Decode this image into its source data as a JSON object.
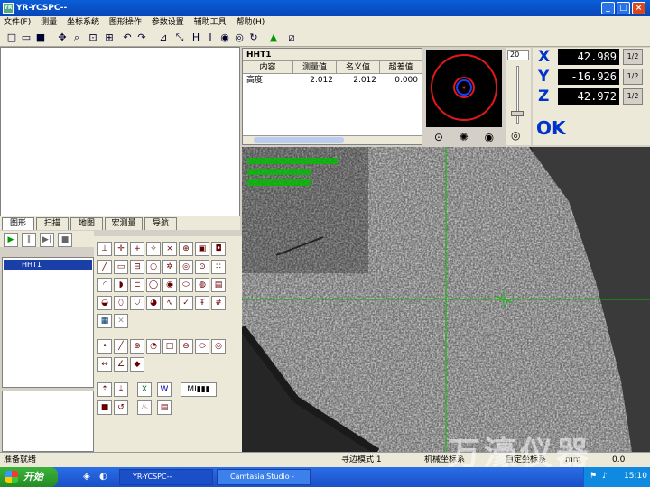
{
  "window": {
    "title": "YR-YCSPC--",
    "controls": [
      "_",
      "□",
      "×"
    ]
  },
  "menu": [
    "文件(F)",
    "测量",
    "坐标系统",
    "图形操作",
    "参数设置",
    "辅助工具",
    "帮助(H)"
  ],
  "toolbar_icons": [
    "new-icon",
    "open-icon",
    "save-icon",
    "move-icon",
    "zoom-icon",
    "zoom-fit-icon",
    "zoom-area-icon",
    "undo-icon",
    "redo-icon",
    "measure-angle-icon",
    "measure-distance-icon",
    "measure-h-icon",
    "measure-z-icon",
    "circle-measure-icon",
    "circle-measure-2-icon",
    "rotate-icon",
    "home-icon",
    "window-icon"
  ],
  "table": {
    "title": "HHT1",
    "columns": [
      "内容",
      "测量值",
      "名义值",
      "超差值"
    ],
    "rows": [
      [
        "高度",
        "2.012",
        "2.012",
        "0.000"
      ]
    ]
  },
  "zoom": {
    "level": "20"
  },
  "coords": {
    "x": "42.989",
    "y": "-16.926",
    "z": "42.972",
    "labels": [
      "X",
      "Y",
      "Z"
    ],
    "ratio": "1/2",
    "status": "OK"
  },
  "tabs": [
    "图形",
    "扫描",
    "地图",
    "宏测量",
    "导航"
  ],
  "tree": {
    "node": "HHT1"
  },
  "status": {
    "ready": "准备就绪",
    "mode": "寻边模式 1",
    "machine": "机械坐标系",
    "user": "自定坐标系",
    "unit": "mm",
    "value": "0.0"
  },
  "taskbar": {
    "start": "开始",
    "tasks": [
      "YR-YCSPC--",
      "Camtasia Studio -"
    ],
    "time": "15:10"
  },
  "watermark": "万濠仪器",
  "colors": {
    "accent": "#0033cc",
    "title": "#0a5ed8",
    "crosshair": "#00c000"
  }
}
